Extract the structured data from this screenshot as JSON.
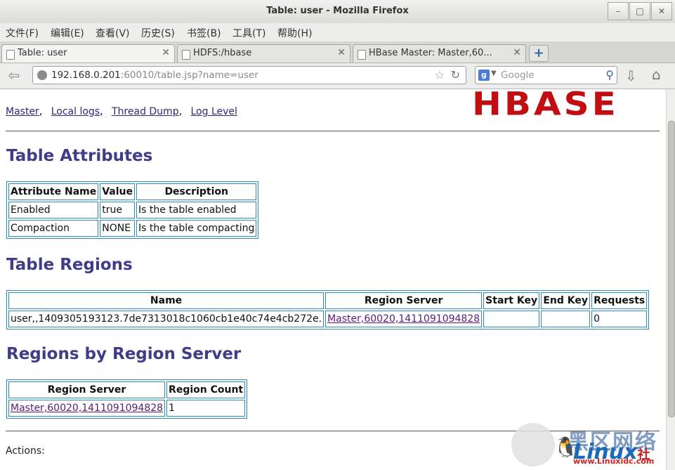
{
  "window": {
    "title": "Table: user - Mozilla Firefox",
    "minimize": "–",
    "maximize": "□",
    "close": "✕"
  },
  "menu": [
    "文件(F)",
    "编辑(E)",
    "查看(V)",
    "历史(S)",
    "书签(B)",
    "工具(T)",
    "帮助(H)"
  ],
  "tabs": [
    {
      "label": "Table: user",
      "active": true
    },
    {
      "label": "HDFS:/hbase",
      "active": false
    },
    {
      "label": "HBase Master: Master,60...",
      "active": false
    }
  ],
  "new_tab": "+",
  "nav": {
    "url_host": "192.168.0.201",
    "url_path": ":60010/table.jsp?name=user",
    "search_placeholder": "Google"
  },
  "page": {
    "logo": "HBASE",
    "links": [
      "Master",
      "Local logs",
      "Thread Dump",
      "Log Level"
    ],
    "table_attributes_heading": "Table Attributes",
    "attributes": {
      "headers": [
        "Attribute Name",
        "Value",
        "Description"
      ],
      "rows": [
        [
          "Enabled",
          "true",
          "Is the table enabled"
        ],
        [
          "Compaction",
          "NONE",
          "Is the table compacting"
        ]
      ]
    },
    "table_regions_heading": "Table Regions",
    "regions": {
      "headers": [
        "Name",
        "Region Server",
        "Start Key",
        "End Key",
        "Requests"
      ],
      "rows": [
        [
          "user,,1409305193123.7de7313018c1060cb1e40c74e4cb272e.",
          "Master,60020,1411091094828",
          "",
          "",
          "0"
        ]
      ]
    },
    "regions_by_server_heading": "Regions by Region Server",
    "by_server": {
      "headers": [
        "Region Server",
        "Region Count"
      ],
      "rows": [
        [
          "Master,60020,1411091094828",
          "1"
        ]
      ]
    },
    "actions_label": "Actions:"
  },
  "watermark": {
    "cn": "黑区网络",
    "brand": "Linux",
    "suffix": "社",
    "url": "www.Linuxidc.com"
  }
}
